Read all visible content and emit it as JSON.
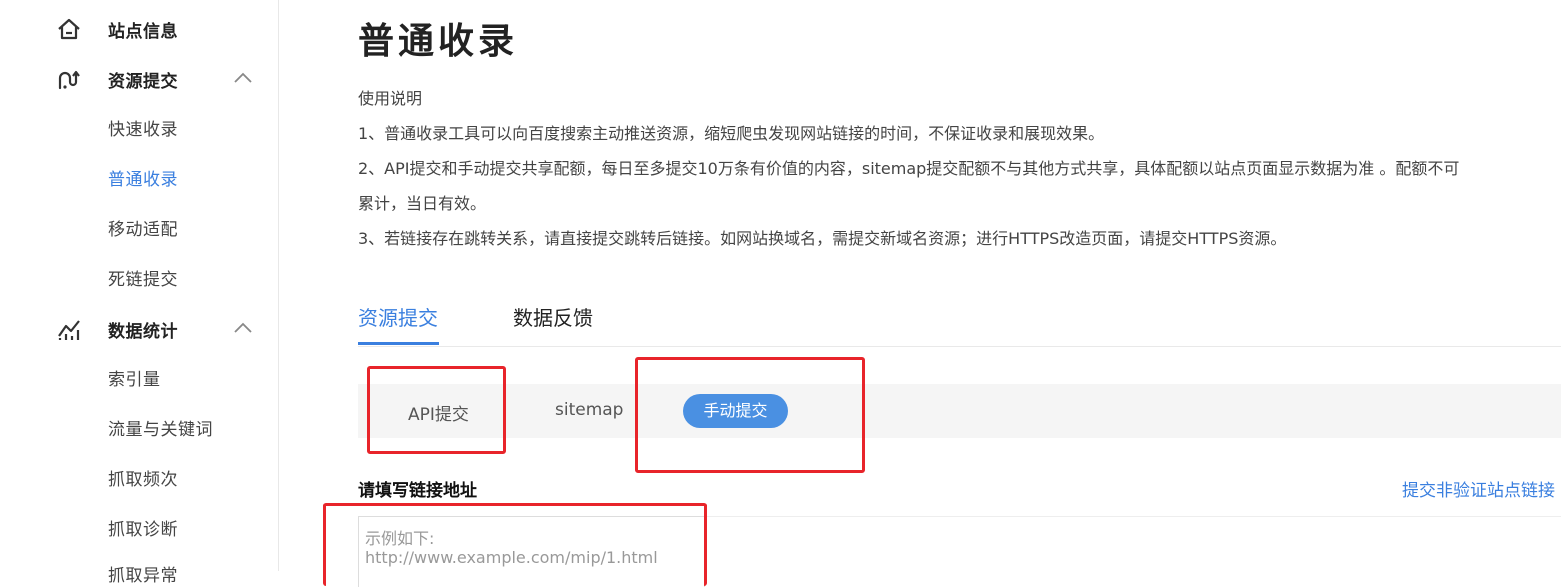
{
  "sidebar": {
    "groups": [
      {
        "label": "站点信息",
        "icon": "home-icon"
      },
      {
        "label": "资源提交",
        "icon": "submit-icon",
        "expanded": true,
        "items": [
          "快速收录",
          "普通收录",
          "移动适配",
          "死链提交"
        ]
      },
      {
        "label": "数据统计",
        "icon": "stats-icon",
        "expanded": true,
        "items": [
          "索引量",
          "流量与关键词",
          "抓取频次",
          "抓取诊断",
          "抓取异常"
        ]
      }
    ],
    "active_item": "普通收录"
  },
  "main": {
    "title": "普通收录",
    "instructions": {
      "heading": "使用说明",
      "line1": "1、普通收录工具可以向百度搜索主动推送资源，缩短爬虫发现网站链接的时间，不保证收录和展现效果。",
      "line2a": "2、API提交和手动提交共享配额，每日至多提交10万条有价值的内容，sitemap提交配额不与其他方式共享，具体配额以站点页面显示数据为准 。配额不可",
      "line2b": "累计，当日有效。",
      "line3": "3、若链接存在跳转关系，请直接提交跳转后链接。如网站换域名，需提交新域名资源；进行HTTPS改造页面，请提交HTTPS资源。"
    },
    "tabs": {
      "items": [
        "资源提交",
        "数据反馈"
      ],
      "active": "资源提交"
    },
    "subtabs": {
      "items": [
        "API提交",
        "sitemap",
        "手动提交"
      ],
      "active": "手动提交"
    },
    "url_label": "请填写链接地址",
    "unverified_link": "提交非验证站点链接",
    "textarea": {
      "placeholder_line1": "示例如下:",
      "placeholder_line2": "http://www.example.com/mip/1.html"
    }
  },
  "colors": {
    "accent": "#3a7fdf",
    "pill": "#4a90e2",
    "annotation": "#e8242a"
  }
}
